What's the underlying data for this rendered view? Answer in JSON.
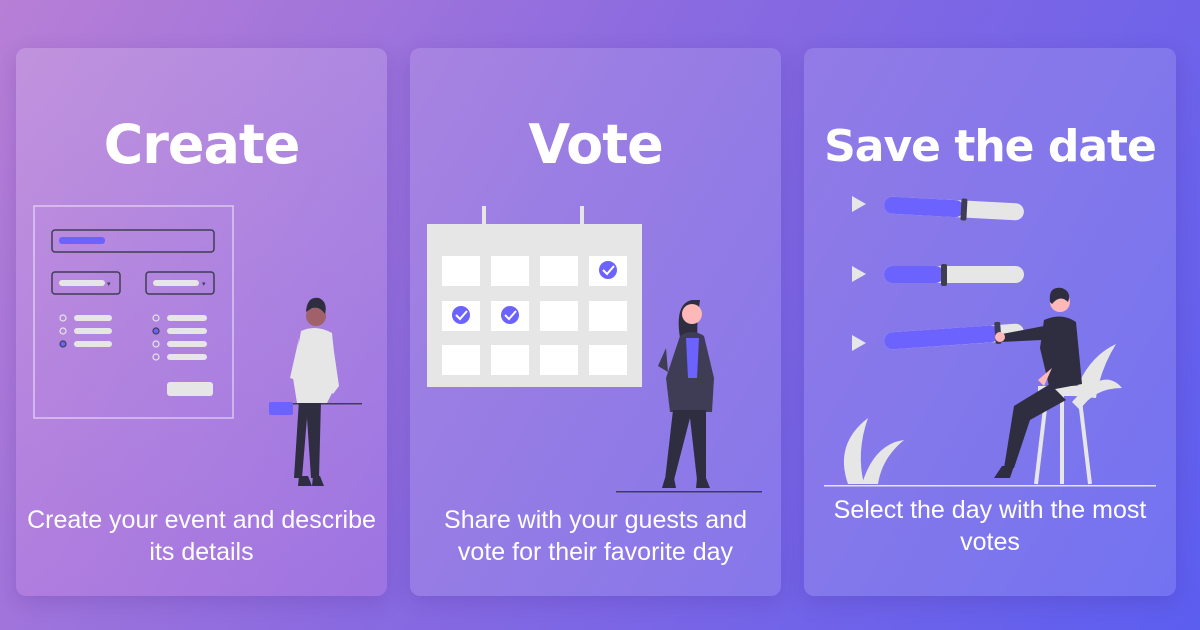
{
  "cards": [
    {
      "title": "Create",
      "description": "Create your event and describe its details"
    },
    {
      "title": "Vote",
      "description": "Share with your guests and vote for their favorite day"
    },
    {
      "title": "Save the date",
      "description": "Select the day with the most votes"
    }
  ],
  "colors": {
    "accent": "#6c63ff",
    "bg_start": "#b87fd6",
    "bg_end": "#5c5ef0",
    "text": "#ffffff",
    "dark": "#2f2e41"
  },
  "icons": [
    "form-illustration",
    "person-illustration",
    "calendar-icon",
    "check-icon",
    "play-icon",
    "slider-illustration",
    "plant-icon",
    "stool-icon"
  ]
}
